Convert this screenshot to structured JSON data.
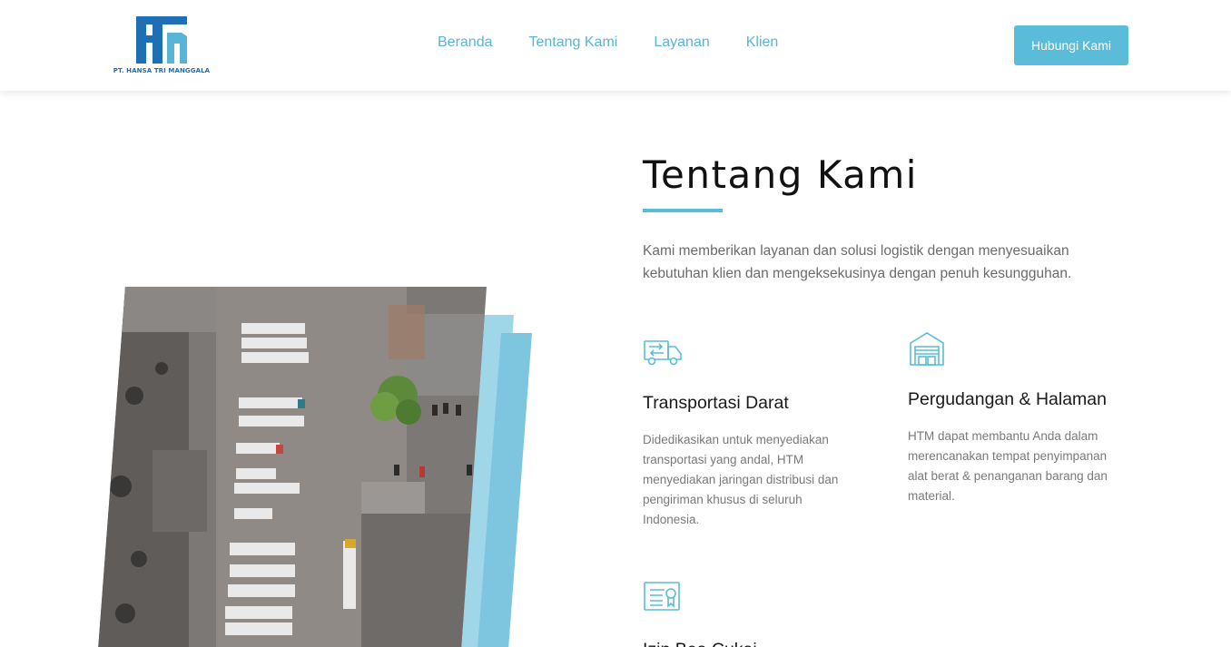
{
  "brand": {
    "company_text": "PT. HANSA TRI MANGGALA",
    "primary_color": "#1f6fb5",
    "accent_color": "#5bbcd9"
  },
  "nav": {
    "items": [
      {
        "label": "Beranda"
      },
      {
        "label": "Tentang Kami"
      },
      {
        "label": "Layanan"
      },
      {
        "label": "Klien"
      }
    ],
    "cta_label": "Hubungi Kami"
  },
  "about": {
    "title": "Tentang Kami",
    "intro": "Kami memberikan layanan dan solusi logistik dengan menyesuaikan kebutuhan klien dan mengeksekusinya dengan penuh kesungguhan."
  },
  "services": [
    {
      "icon": "truck-icon",
      "title": "Transportasi Darat",
      "description": "Didedikasikan untuk menyediakan transportasi yang andal, HTM menyediakan jaringan distribusi dan pengiriman khusus di seluruh Indonesia."
    },
    {
      "icon": "warehouse-icon",
      "title": "Pergudangan & Halaman",
      "description": "HTM dapat membantu Anda dalam merencanakan tempat penyimpanan alat berat & penanganan barang dan material."
    },
    {
      "icon": "certificate-icon",
      "title": "Izin Bea Cukai",
      "description": ""
    }
  ]
}
